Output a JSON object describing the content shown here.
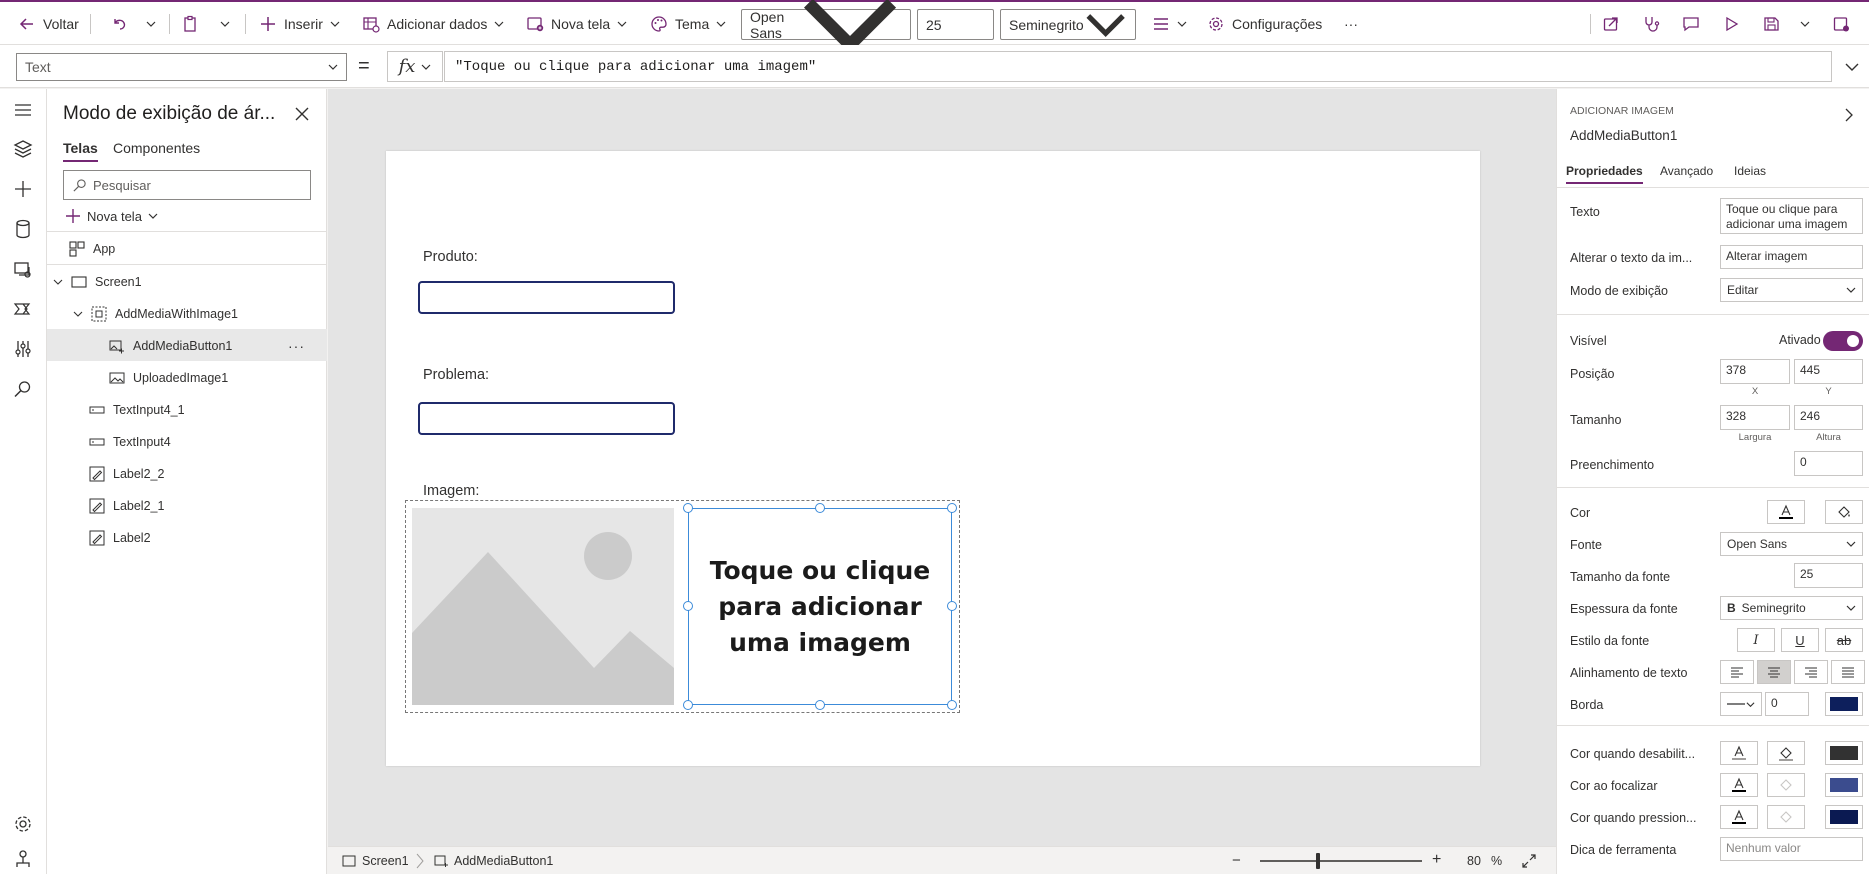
{
  "toolbar": {
    "back_label": "Voltar",
    "insert_label": "Inserir",
    "add_data_label": "Adicionar dados",
    "new_screen_label": "Nova tela",
    "theme_label": "Tema",
    "font_value": "Open Sans",
    "font_size_value": "25",
    "font_weight_value": "Seminegrito",
    "settings_label": "Configurações",
    "more_label": "···",
    "accent_color": "#742774"
  },
  "formula_bar": {
    "property": "Text",
    "equals": "=",
    "fx": "fx",
    "formula": "\"Toque ou clique para adicionar uma imagem\""
  },
  "tree": {
    "title": "Modo de exibição de ár...",
    "tabs": [
      "Telas",
      "Componentes"
    ],
    "search_placeholder": "Pesquisar",
    "new_screen_label": "Nova tela",
    "items": [
      {
        "label": "App",
        "icon": "app-icon"
      },
      {
        "label": "Screen1",
        "icon": "screen-icon"
      },
      {
        "label": "AddMediaWithImage1",
        "icon": "group-icon"
      },
      {
        "label": "AddMediaButton1",
        "icon": "add-media-icon"
      },
      {
        "label": "UploadedImage1",
        "icon": "image-icon"
      },
      {
        "label": "TextInput4_1",
        "icon": "text-input-icon"
      },
      {
        "label": "TextInput4",
        "icon": "text-input-icon"
      },
      {
        "label": "Label2_2",
        "icon": "label-icon"
      },
      {
        "label": "Label2_1",
        "icon": "label-icon"
      },
      {
        "label": "Label2",
        "icon": "label-icon"
      }
    ],
    "item_more": "···"
  },
  "canvas": {
    "label_produto": "Produto:",
    "label_problema": "Problema:",
    "label_imagem": "Imagem:",
    "add_media_text": "Toque ou clique para adicionar uma imagem"
  },
  "statusbar": {
    "screen_crumb": "Screen1",
    "control_crumb": "AddMediaButton1",
    "zoom_minus": "−",
    "zoom_plus": "+",
    "zoom_value": "80",
    "zoom_unit": "%",
    "zoom_fraction": 0.36
  },
  "props": {
    "type": "ADICIONAR IMAGEM",
    "name": "AddMediaButton1",
    "tabs": [
      "Propriedades",
      "Avançado",
      "Ideias"
    ],
    "text_label": "Texto",
    "text_value": "Toque ou clique para adicionar uma imagem",
    "change_text_label": "Alterar o texto da im...",
    "change_text_value": "Alterar imagem",
    "display_mode_label": "Modo de exibição",
    "display_mode_value": "Editar",
    "visible_label": "Visível",
    "visible_value": "Ativado",
    "position_label": "Posição",
    "pos_x": "378",
    "pos_y": "445",
    "x_label": "X",
    "y_label": "Y",
    "size_label": "Tamanho",
    "width": "328",
    "height": "246",
    "width_label": "Largura",
    "height_label": "Altura",
    "padding_label": "Preenchimento",
    "padding_value": "0",
    "color_label": "Cor",
    "font_label": "Fonte",
    "font_value": "Open Sans",
    "font_size_label": "Tamanho da fonte",
    "font_size_value": "25",
    "font_weight_label": "Espessura da fonte",
    "font_weight_value": "Seminegrito",
    "font_style_label": "Estilo da fonte",
    "text_align_label": "Alinhamento de texto",
    "border_label": "Borda",
    "border_value": "0",
    "border_color": "#0d1f5c",
    "disabled_color_label": "Cor quando desabilit...",
    "disabled_color": "#323232",
    "hover_color_label": "Cor ao focalizar",
    "hover_color": "#3b4c8e",
    "pressed_color_label": "Cor quando pression...",
    "pressed_color": "#0b1a52",
    "tooltip_label": "Dica de ferramenta",
    "tooltip_placeholder": "Nenhum valor"
  }
}
